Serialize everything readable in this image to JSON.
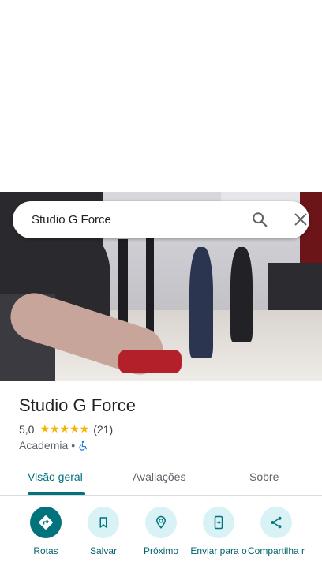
{
  "search": {
    "query": "Studio G Force"
  },
  "place": {
    "name": "Studio G Force",
    "rating": "5,0",
    "stars": "★★★★★",
    "review_count": "(21)",
    "category": "Academia",
    "separator": "•"
  },
  "tabs": [
    {
      "label": "Visão geral",
      "active": true
    },
    {
      "label": "Avaliações",
      "active": false
    },
    {
      "label": "Sobre",
      "active": false
    }
  ],
  "actions": [
    {
      "label": "Rotas",
      "icon": "directions-icon"
    },
    {
      "label": "Salvar",
      "icon": "bookmark-icon"
    },
    {
      "label": "Próximo",
      "icon": "nearby-icon"
    },
    {
      "label": "Enviar para o",
      "icon": "send-to-phone-icon"
    },
    {
      "label": "Compartilha r",
      "icon": "share-icon"
    }
  ],
  "colors": {
    "accent": "#00737c",
    "action_bg": "#d9f2f6",
    "star": "#f4b400"
  }
}
